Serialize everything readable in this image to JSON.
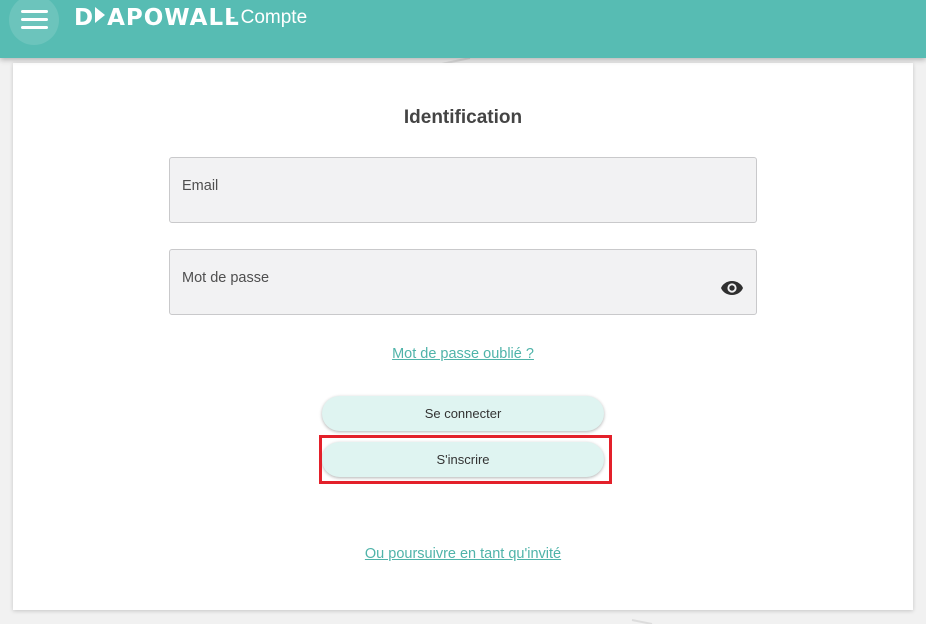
{
  "header": {
    "logo_text": "DIAPOWALL",
    "logo_prefix": "D",
    "logo_suffix": "APOWALL",
    "page_title": "- Compte",
    "menu_icon": "hamburger-menu-icon",
    "colors": {
      "bar": "#57bcb3",
      "text": "#ffffff"
    }
  },
  "login": {
    "title": "Identification",
    "email": {
      "label": "Email",
      "value": ""
    },
    "password": {
      "label": "Mot de passe",
      "value": "",
      "toggle_icon": "eye-icon"
    },
    "forgot_link": "Mot de passe oublié ?",
    "signin_button": "Se connecter",
    "signup_button": "S'inscrire",
    "guest_link": "Ou poursuivre en tant qu'invité",
    "colors": {
      "accent": "#4fb3a9",
      "button_bg": "#dff4f1",
      "highlight": "#e3202a"
    }
  }
}
